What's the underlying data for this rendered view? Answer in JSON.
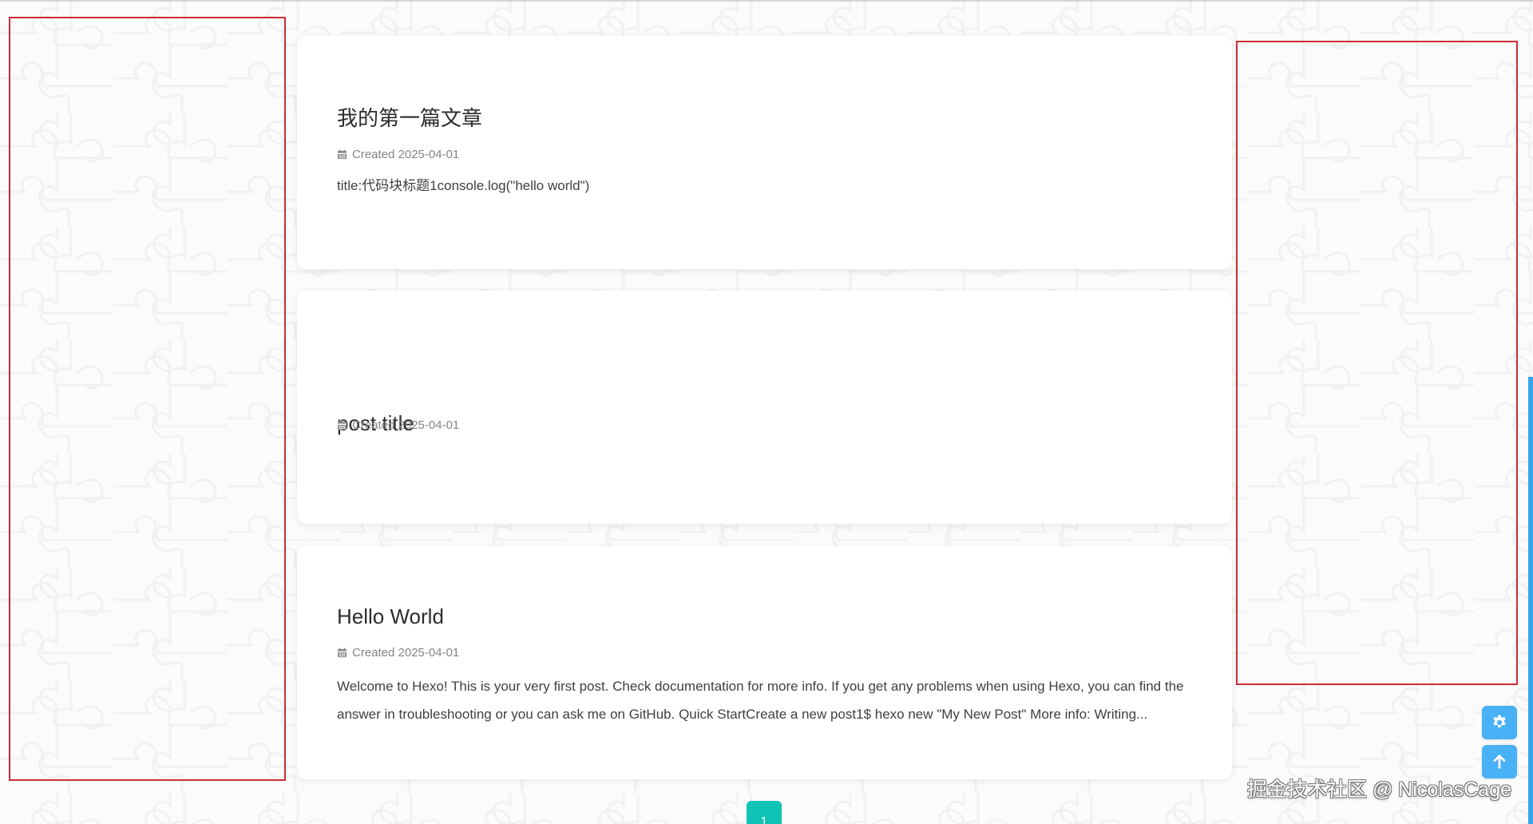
{
  "page": {
    "background": "#fbfbfb",
    "accent": "#49b1f5",
    "pagination_color": "#10c3b7",
    "annotation_color": "#cc2d36"
  },
  "posts": [
    {
      "title": "我的第一篇文章",
      "meta_icon": "calendar-icon",
      "meta": "Created 2025-04-01",
      "excerpt": "title:代码块标题1console.log(\"hello world\")"
    },
    {
      "title": "post title",
      "meta_icon": "calendar-icon",
      "meta": "Created 2025-04-01",
      "excerpt": ""
    },
    {
      "title": "Hello World",
      "meta_icon": "calendar-icon",
      "meta": "Created 2025-04-01",
      "excerpt": "Welcome to Hexo! This is your very first post. Check documentation for more info. If you get any problems when using Hexo, you can find the answer in troubleshooting or you can ask me on GitHub. Quick StartCreate a new post1$ hexo new \"My New Post\" More info: Writing..."
    }
  ],
  "floating_buttons": [
    {
      "icon": "gear-icon"
    },
    {
      "icon": "arrow-up-icon"
    }
  ],
  "pagination": {
    "current": "1"
  },
  "watermark": {
    "text": "掘金技术社区 @ NicolasCage"
  }
}
